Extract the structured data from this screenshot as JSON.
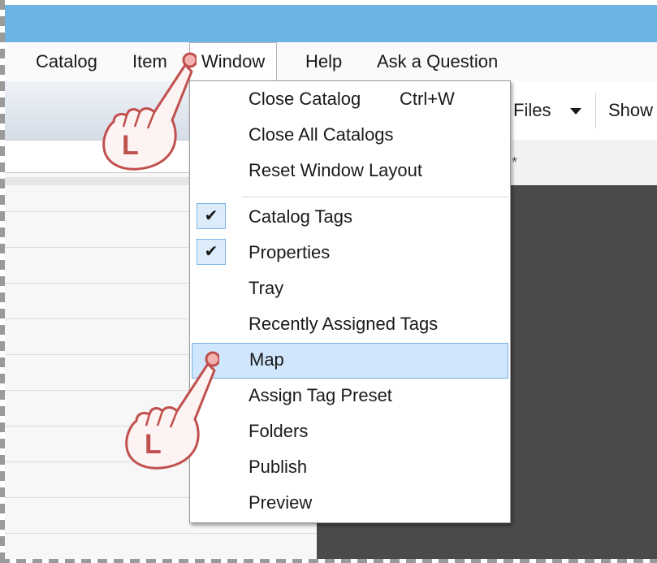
{
  "menubar": {
    "items": [
      {
        "label": "Catalog"
      },
      {
        "label": "Item"
      },
      {
        "label": "Window"
      },
      {
        "label": "Help"
      },
      {
        "label": "Ask a Question"
      }
    ]
  },
  "toolbar": {
    "files_label": "Files",
    "show_label": "Show"
  },
  "right_header": {
    "mark": "*"
  },
  "window_menu": {
    "items": [
      {
        "label": "Close Catalog",
        "shortcut": "Ctrl+W"
      },
      {
        "label": "Close All Catalogs"
      },
      {
        "label": "Reset Window Layout"
      },
      {
        "label": "Catalog Tags",
        "checked": true
      },
      {
        "label": "Properties",
        "checked": true
      },
      {
        "label": "Tray"
      },
      {
        "label": "Recently Assigned Tags"
      },
      {
        "label": "Map",
        "highlighted": true
      },
      {
        "label": "Assign Tag Preset"
      },
      {
        "label": "Folders"
      },
      {
        "label": "Publish"
      },
      {
        "label": "Preview"
      }
    ],
    "check_glyph": "✔"
  },
  "annotations": {
    "hand_label": "L"
  },
  "colors": {
    "titlebar": "#6cb4e3",
    "highlight": "#cfe6fc",
    "hand_stroke": "#c0504d",
    "dark_pane": "#4a4a4a"
  }
}
